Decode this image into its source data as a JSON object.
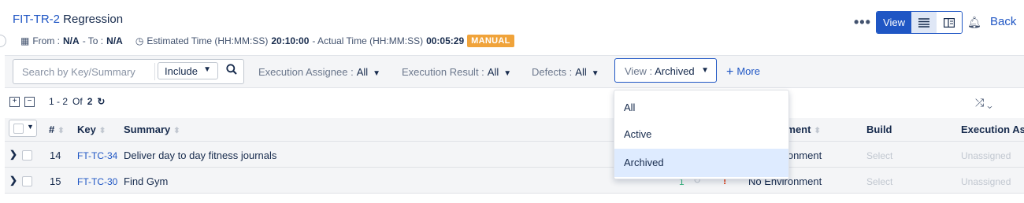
{
  "header": {
    "key": "FIT-TR-2",
    "name": "Regression",
    "from_label": "From :",
    "from_value": "N/A",
    "to_label": "- To :",
    "to_value": "N/A",
    "estimated_label": "Estimated Time (HH:MM:SS)",
    "estimated_value": "20:10:00",
    "actual_label": "- Actual Time (HH:MM:SS)",
    "actual_value": "00:05:29",
    "type_badge": "MANUAL"
  },
  "toolbar": {
    "more_dots": "•••",
    "view_label": "View",
    "back_label": "Back"
  },
  "filters": {
    "search_placeholder": "Search by Key/Summary",
    "include_label": "Include",
    "assignee_label": "Execution Assignee :",
    "assignee_value": "All",
    "result_label": "Execution Result :",
    "result_value": "All",
    "defects_label": "Defects :",
    "defects_value": "All",
    "view_label": "View :",
    "view_value": "Archived",
    "more_label": "More"
  },
  "pager": {
    "range": "1 - 2",
    "of_label": "Of",
    "total": "2"
  },
  "columns": {
    "num": "#",
    "key": "Key",
    "summary": "Summary",
    "environment": "Environment",
    "build": "Build",
    "assignee": "Execution As"
  },
  "rows": [
    {
      "num": "14",
      "key": "FT-TC-34",
      "summary": "Deliver day to day fitness journals",
      "count": "",
      "environment": "No Environment",
      "build": "Select",
      "assignee": "Unassigned"
    },
    {
      "num": "15",
      "key": "FT-TC-30",
      "summary": "Find Gym",
      "count": "1",
      "environment": "No Environment",
      "build": "Select",
      "assignee": "Unassigned"
    }
  ],
  "view_dropdown": {
    "options": [
      "All",
      "Active",
      "Archived"
    ],
    "selected": "Archived"
  },
  "colors": {
    "brand_blue": "#1f56c4",
    "manual_badge": "#f0a33a",
    "selected_option_bg": "#deebff"
  }
}
